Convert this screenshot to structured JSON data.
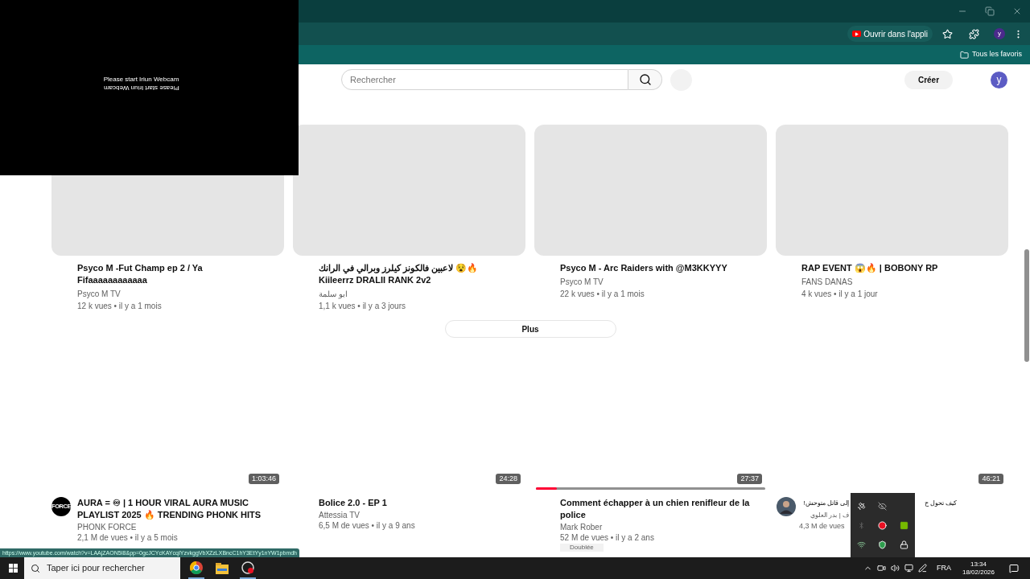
{
  "webcam_overlay": {
    "message": "Please start Iriun Webcam",
    "mirrored_message": "Please start Iriun Webcam"
  },
  "browser": {
    "open_in_app": "Ouvrir dans l'appli",
    "profile_initial": "y",
    "bookmarks_folder": "Tous les favoris"
  },
  "header": {
    "search_placeholder": "Rechercher",
    "create": "Créer",
    "avatar_initial": "y"
  },
  "videos_top": [
    {
      "title": "Psyco M -Fut Champ ep 2 / Ya Fifaaaaaaaaaaaa",
      "channel": "Psyco M TV",
      "meta": "12 k vues • il y a 1 mois"
    },
    {
      "title": "لاعبين فالكونز كيلرز وبرالي في الرانك 😵🔥 Kiileerrz DRALII RANK 2v2",
      "channel": "ابو سلمة",
      "meta": "1,1 k vues • il y a 3 jours"
    },
    {
      "title": "Psyco M - Arc Raiders with @M3KKYYY",
      "channel": "Psyco M TV",
      "meta": "22 k vues • il y a 1 mois"
    },
    {
      "title": "RAP EVENT 😱🔥 | BOBONY RP",
      "channel": "FANS DANAS",
      "meta": "4 k vues • il y a 1 jour"
    }
  ],
  "more_button": "Plus",
  "videos_bottom": [
    {
      "duration": "1:03:46",
      "avatar": {
        "kind": "logo",
        "text": "FORCE"
      },
      "title": "AURA = ♾ | 1 HOUR VIRAL AURA MUSIC PLAYLIST 2025 🔥 TRENDING PHONK HITS",
      "channel": "PHONK FORCE",
      "meta": "2,1 M de vues • il y a 5 mois"
    },
    {
      "duration": "24:28",
      "title": "Bolice 2.0 - EP 1",
      "channel": "Attessia TV",
      "meta": "6,5 M de vues • il y a 9 ans"
    },
    {
      "duration": "27:37",
      "level": 0.09,
      "title": "Comment échapper à un chien renifleur de la police",
      "channel": "Mark Rober",
      "meta": "52 M de vues • il y a 2 ans",
      "badge": "Doublée"
    },
    {
      "duration": "46:21",
      "avatar": {
        "kind": "person"
      },
      "title_parts": [
        "كيف تحول ح",
        "إلى قاتل متوحش!"
      ],
      "channel": "ف | بدر العلوي",
      "meta": "4,3 M de vues"
    }
  ],
  "status_url": "https://www.youtube.com/watch?v=LAAjZAON5I8&pp=0gcJCYcKAYcqIYzvkggVbXZzLXBncC1hY3EtYy1nYW1pbmdh",
  "taskbar": {
    "search_placeholder": "Taper ici pour rechercher",
    "language": "FRA",
    "time": "13:34",
    "date": "18/02/2026"
  }
}
